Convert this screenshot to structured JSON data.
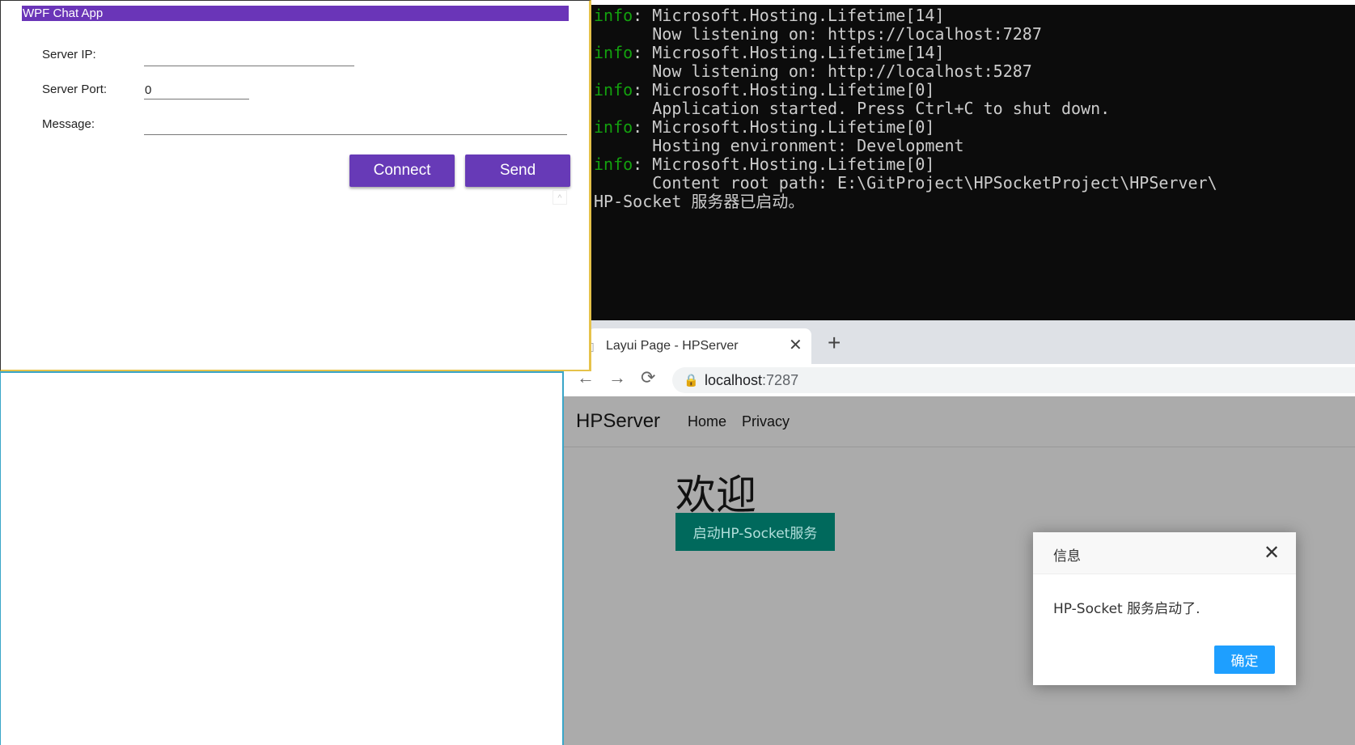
{
  "wpf": {
    "title": "WPF Chat App",
    "server_ip_label": "Server IP:",
    "server_ip_value": "",
    "server_port_label": "Server Port:",
    "server_port_value": "0",
    "message_label": "Message:",
    "message_value": "",
    "connect_label": "Connect",
    "send_label": "Send",
    "scroll_glyph": "^"
  },
  "console": {
    "lines": [
      {
        "prefix": "info",
        "text": ": Microsoft.Hosting.Lifetime[14]"
      },
      {
        "prefix": "",
        "text": "      Now listening on: https://localhost:7287"
      },
      {
        "prefix": "info",
        "text": ": Microsoft.Hosting.Lifetime[14]"
      },
      {
        "prefix": "",
        "text": "      Now listening on: http://localhost:5287"
      },
      {
        "prefix": "info",
        "text": ": Microsoft.Hosting.Lifetime[0]"
      },
      {
        "prefix": "",
        "text": "      Application started. Press Ctrl+C to shut down."
      },
      {
        "prefix": "info",
        "text": ": Microsoft.Hosting.Lifetime[0]"
      },
      {
        "prefix": "",
        "text": "      Hosting environment: Development"
      },
      {
        "prefix": "info",
        "text": ": Microsoft.Hosting.Lifetime[0]"
      },
      {
        "prefix": "",
        "text": "      Content root path: E:\\GitProject\\HPSocketProject\\HPServer\\"
      },
      {
        "prefix": "",
        "text": "HP-Socket 服务器已启动。"
      }
    ]
  },
  "browser": {
    "tab_title": "Layui Page - HPServer",
    "tab_close_glyph": "✕",
    "new_tab_glyph": "+",
    "back_glyph": "←",
    "forward_glyph": "→",
    "reload_glyph": "⟳",
    "lock_glyph": "🔒",
    "url_host": "localhost",
    "url_port": ":7287",
    "page_icon_glyph": "▯"
  },
  "page": {
    "brand": "HPServer",
    "nav_home": "Home",
    "nav_privacy": "Privacy",
    "welcome": "欢迎",
    "start_button": "启动HP-Socket服务"
  },
  "dialog": {
    "title": "信息",
    "close_glyph": "✕",
    "message": "HP-Socket 服务启动了.",
    "ok_label": "确定"
  },
  "colors": {
    "wpf_accent": "#673ab7",
    "console_info": "#13a10e",
    "layui_green": "#00695c",
    "layui_blue": "#1e9fff"
  }
}
